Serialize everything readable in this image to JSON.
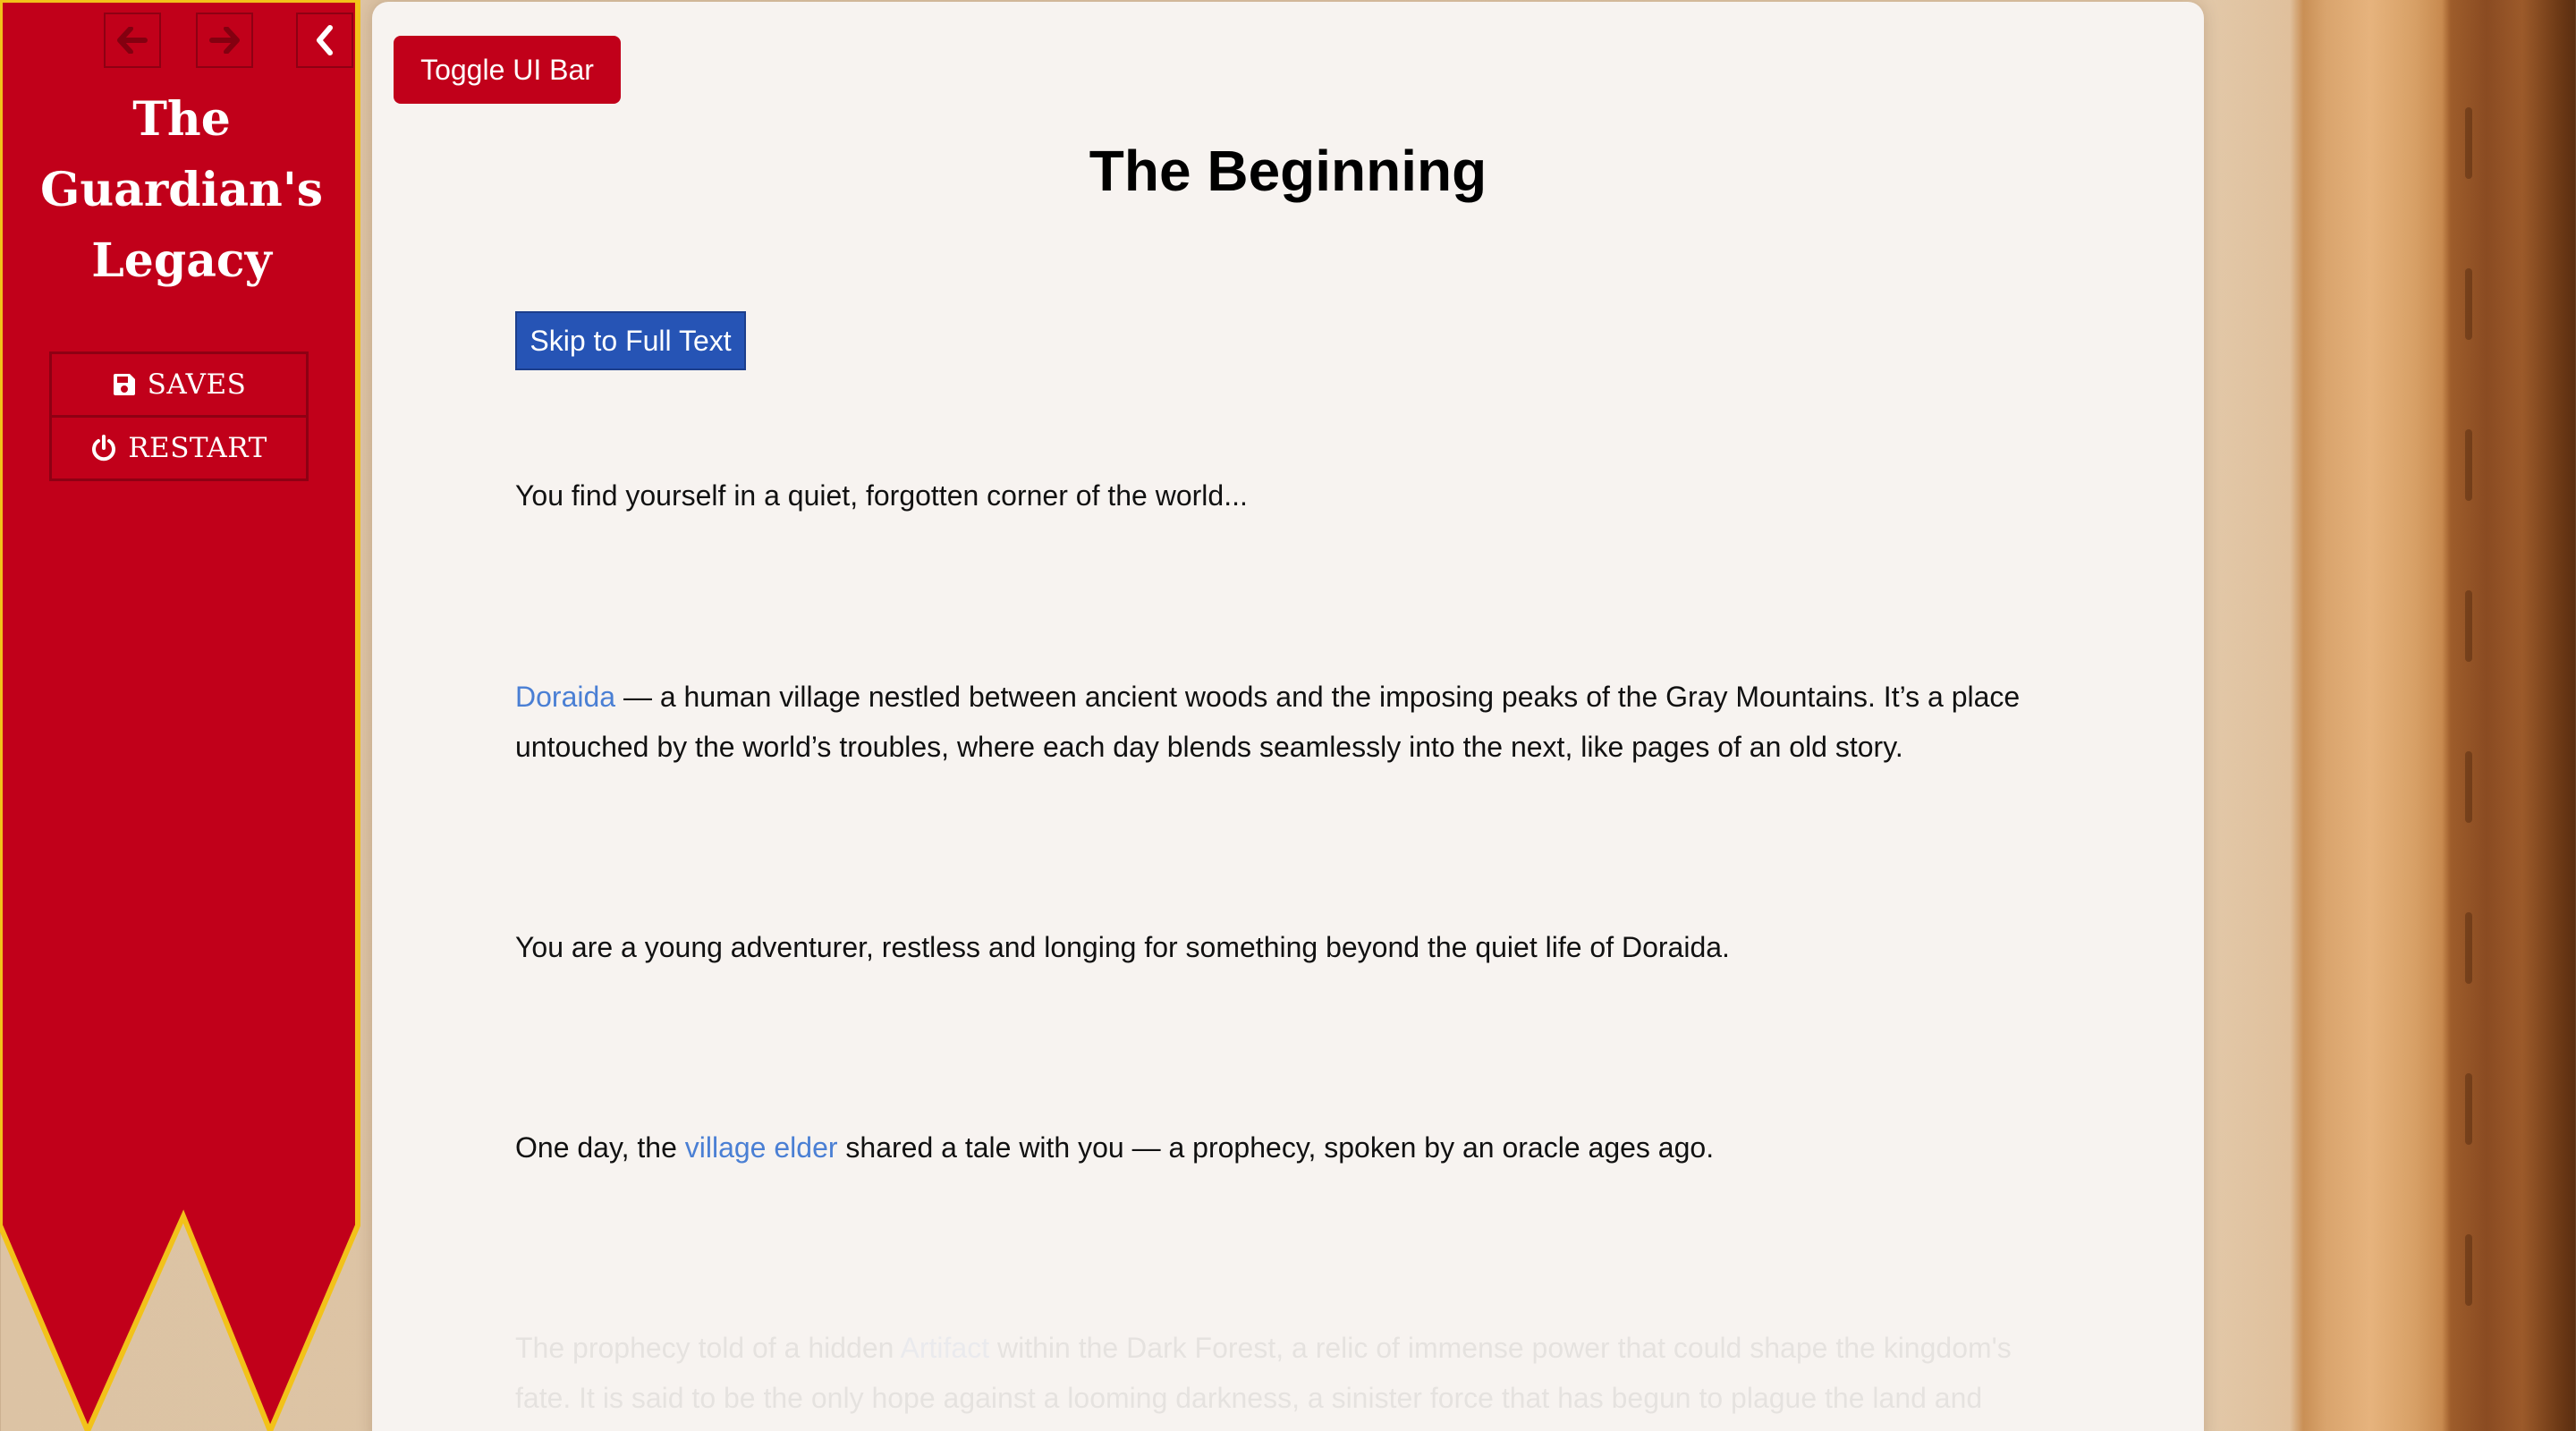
{
  "ui_bar": {
    "history": {
      "back_icon": "arrow-left-icon",
      "forward_icon": "arrow-right-icon",
      "stow_icon": "chevron-left-icon"
    },
    "story_title_lines": [
      "The",
      "Guardian's",
      "Legacy"
    ],
    "menu": {
      "saves_label": "SAVES",
      "saves_icon": "floppy-disk-icon",
      "restart_label": "RESTART",
      "restart_icon": "power-icon"
    },
    "colors": {
      "banner_red": "#c1001a",
      "banner_border": "#f2c21a"
    }
  },
  "passage": {
    "toggle_label": "Toggle UI Bar",
    "title": "The Beginning",
    "skip_label": "Skip to Full Text",
    "p1": "You find yourself in a quiet, forgotten corner of the world...",
    "p2_link": "Doraida",
    "p2_text": " — a human village nestled between ancient woods and the imposing peaks of the Gray Mountains. It’s a place untouched by the world’s troubles, where each day blends seamlessly into the next, like pages of an old story.",
    "p3": "You are a young adventurer, restless and longing for something beyond the quiet life of Doraida.",
    "p4_pre": "One day, the ",
    "p4_link": "village elder",
    "p4_post": " shared a tale with you — a prophecy, spoken by an oracle ages ago.",
    "p5_pre": "The prophecy told of a hidden ",
    "p5_link": "Artifact",
    "p5_post": " within the Dark Forest, a relic of immense power that could shape the kingdom's fate. It is said to be the only hope against a looming darkness, a sinister force that has begun to plague the land and",
    "colors": {
      "page_bg": "#f7f3f0",
      "toggle_bg": "#c1001a",
      "skip_bg": "#2654b5",
      "link": "#4a7fd4"
    }
  }
}
